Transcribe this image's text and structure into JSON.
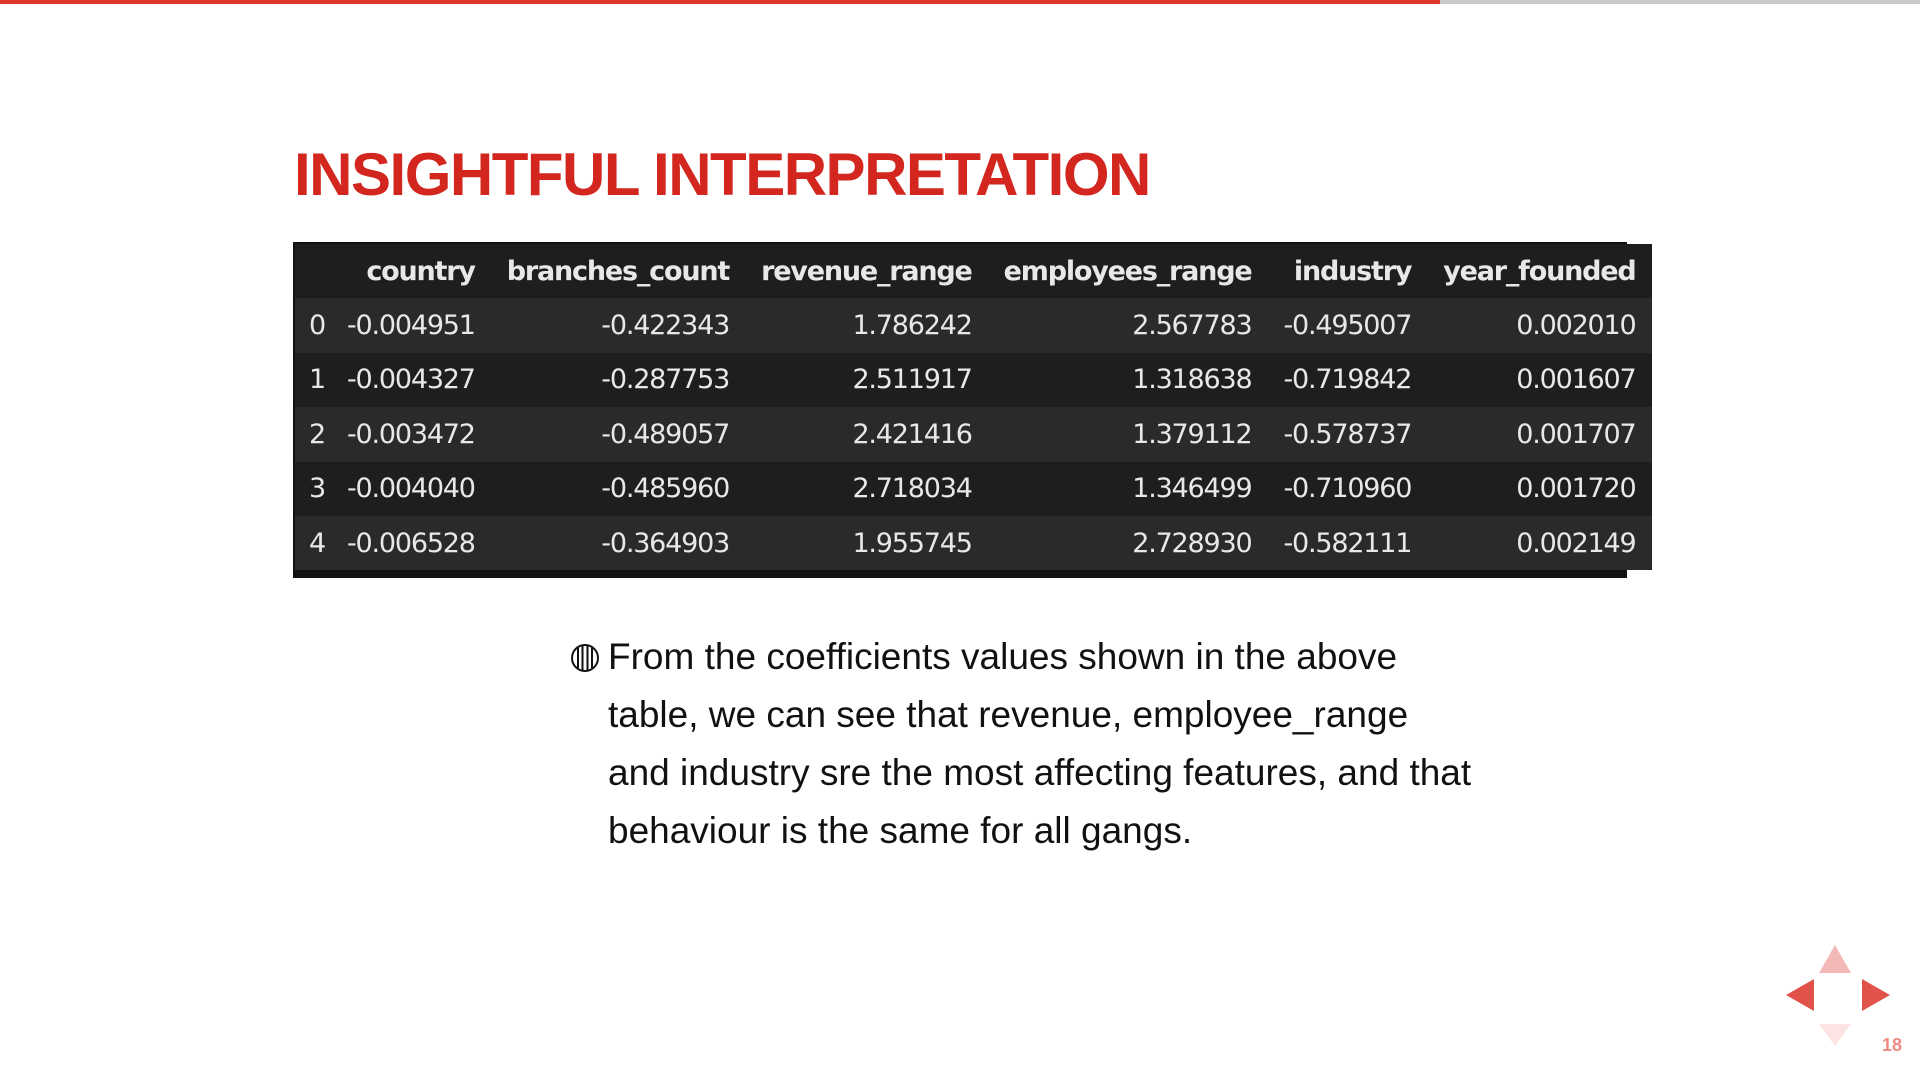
{
  "slide": {
    "progress": 0.75,
    "title": "INSIGHTFUL INTERPRETATION",
    "page_number": "18"
  },
  "table": {
    "columns": [
      "",
      "country",
      "branches_count",
      "revenue_range",
      "employees_range",
      "industry",
      "year_founded"
    ],
    "rows": [
      [
        "0",
        "-0.004951",
        "-0.422343",
        "1.786242",
        "2.567783",
        "-0.495007",
        "0.002010"
      ],
      [
        "1",
        "-0.004327",
        "-0.287753",
        "2.511917",
        "1.318638",
        "-0.719842",
        "0.001607"
      ],
      [
        "2",
        "-0.003472",
        "-0.489057",
        "2.421416",
        "1.379112",
        "-0.578737",
        "0.001707"
      ],
      [
        "3",
        "-0.004040",
        "-0.485960",
        "2.718034",
        "1.346499",
        "-0.710960",
        "0.001720"
      ],
      [
        "4",
        "-0.006528",
        "-0.364903",
        "1.955745",
        "2.728930",
        "-0.582111",
        "0.002149"
      ]
    ]
  },
  "bullet": {
    "icon": "circle-lines-bullet-icon",
    "lines": [
      "From the coefficients values shown in the above",
      "table, we can see that revenue, employee_range",
      "and industry sre the most affecting features, and that",
      "behaviour is the same for all gangs."
    ]
  },
  "nav": {
    "active_color": "#e0524a",
    "inactive_color": "#f3b9b6"
  },
  "colors": {
    "accent": "#d3261f",
    "progress": "#e0352b",
    "table_bg": "#1e1e1e",
    "table_text": "#e8e8e8"
  }
}
